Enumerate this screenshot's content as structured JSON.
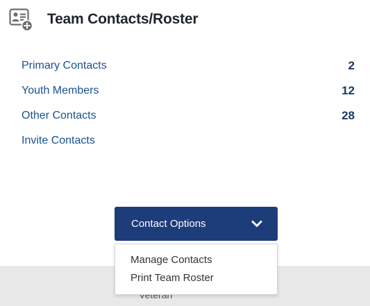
{
  "header": {
    "title": "Team Contacts/Roster",
    "icon": "contact-card-add-icon"
  },
  "contacts": [
    {
      "label": "Primary Contacts",
      "count": "2"
    },
    {
      "label": "Youth Members",
      "count": "12"
    },
    {
      "label": "Other Contacts",
      "count": "28"
    },
    {
      "label": "Invite Contacts",
      "count": ""
    }
  ],
  "options_button": {
    "label": "Contact Options",
    "icon": "chevron-down-icon"
  },
  "dropdown": {
    "items": [
      "Manage Contacts",
      "Print Team Roster"
    ]
  },
  "background": {
    "partial_text": "Veteran"
  },
  "colors": {
    "accent": "#1d3c7a",
    "link": "#1a5192",
    "count": "#1a3a66",
    "band": "#e9e9e9"
  }
}
